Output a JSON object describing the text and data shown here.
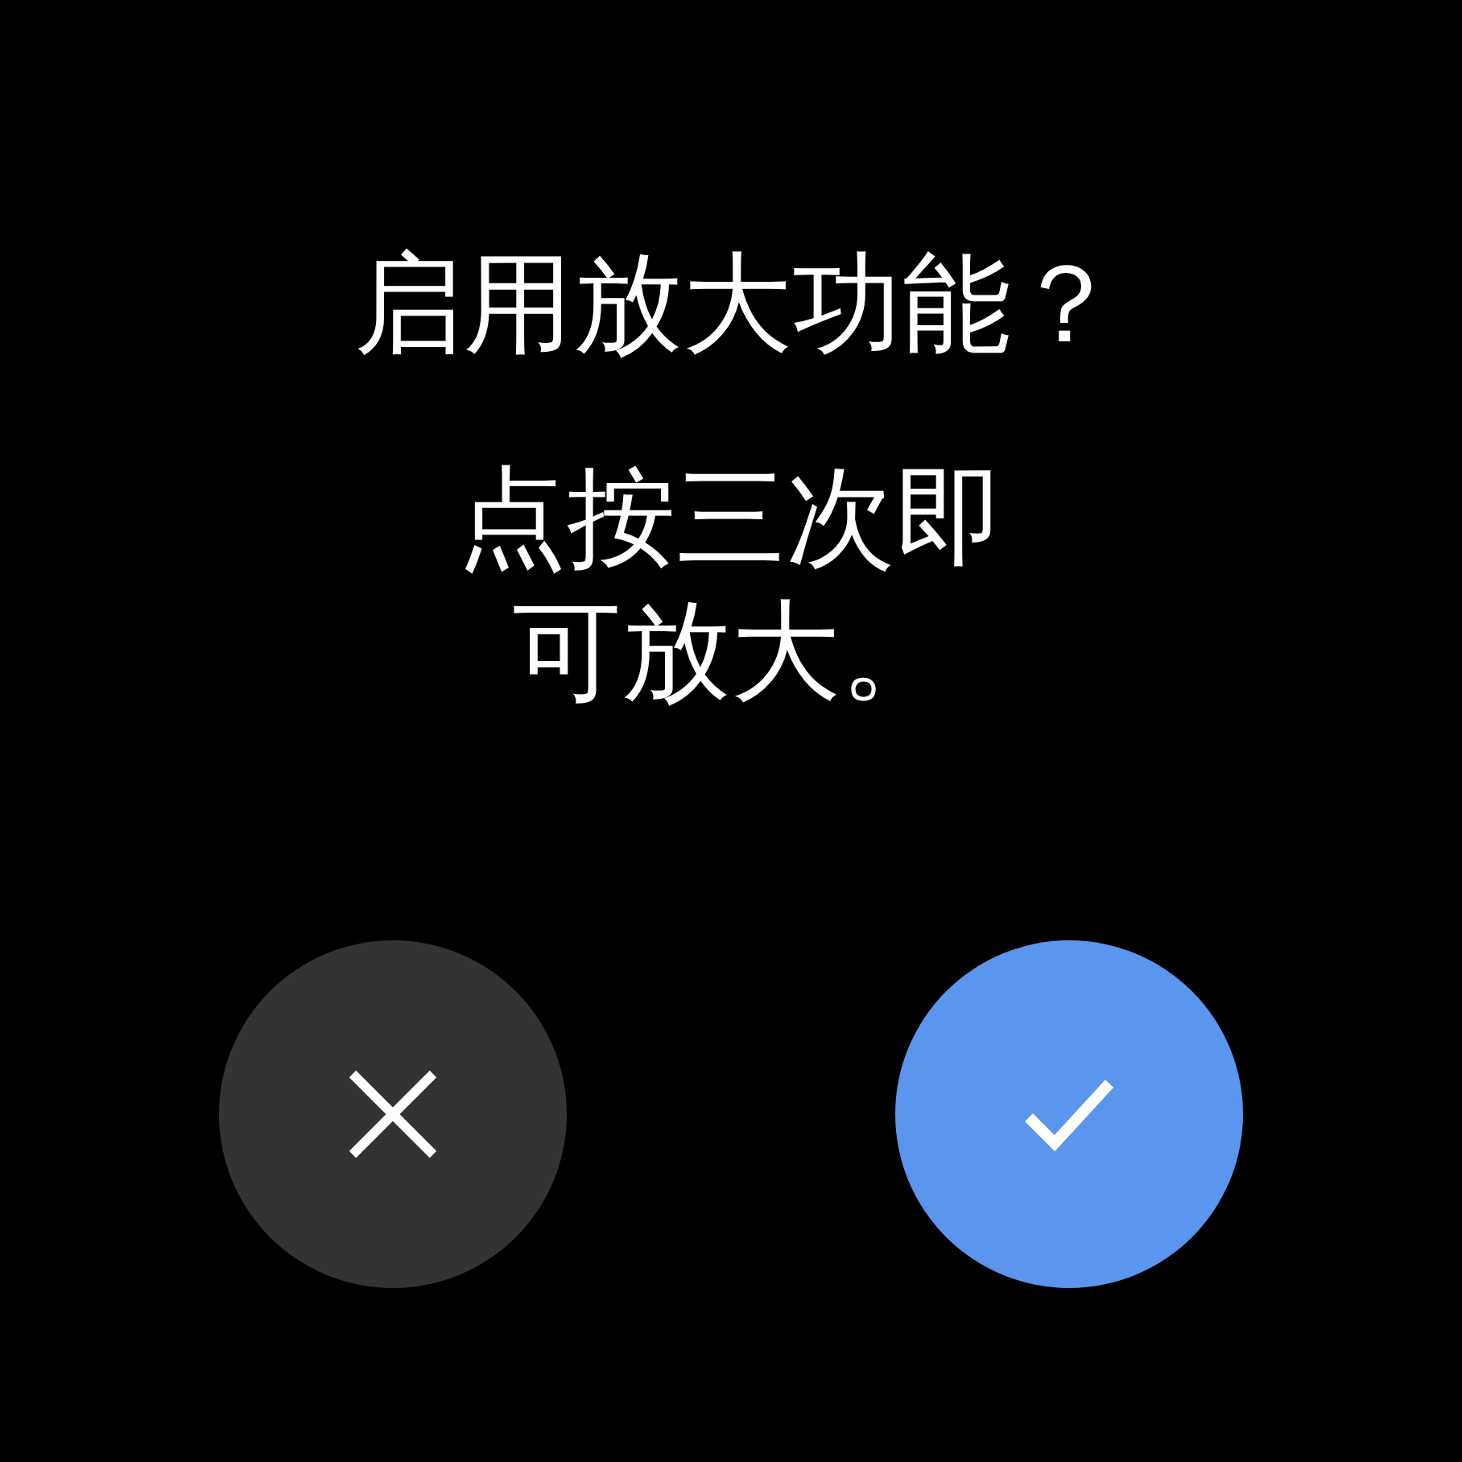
{
  "title": "启用放大功能？",
  "message": "点按三次即可放大。",
  "buttons": [
    {
      "kind": "cancel"
    },
    {
      "kind": "confirm"
    }
  ]
}
